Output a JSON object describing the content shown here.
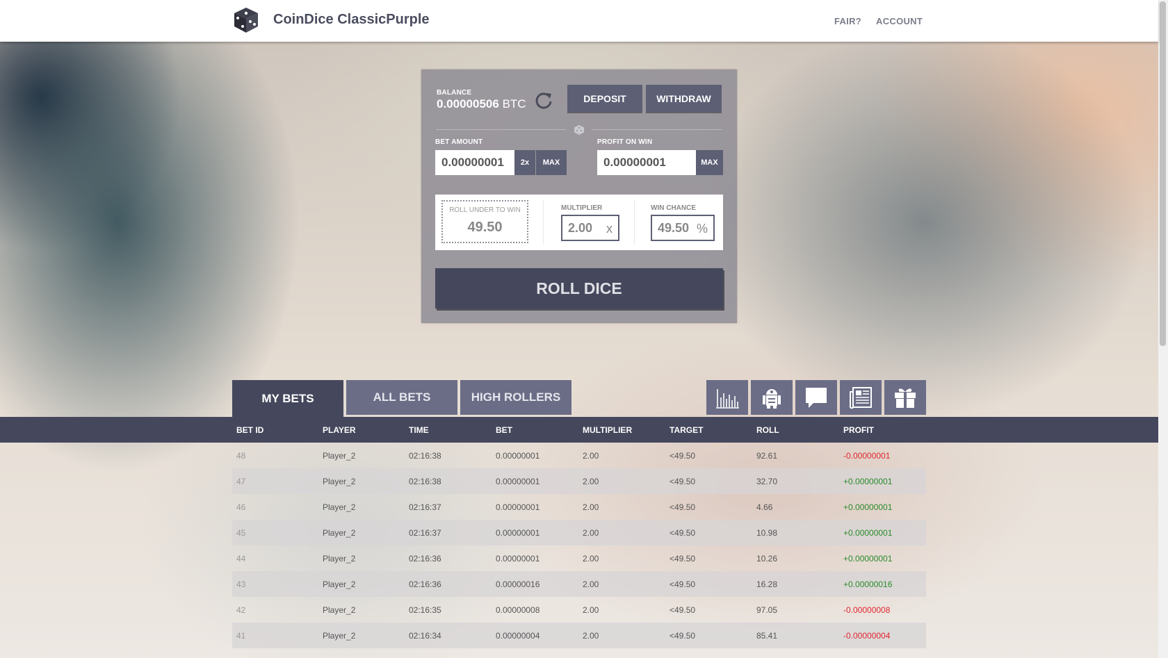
{
  "header": {
    "brand": "CoinDice ClassicPurple",
    "nav": [
      "FAIR?",
      "ACCOUNT"
    ]
  },
  "panel": {
    "balance_label": "BALANCE",
    "balance_value": "0.00000506",
    "balance_unit": "BTC",
    "deposit_label": "DEPOSIT",
    "withdraw_label": "WITHDRAW",
    "bet_amount_label": "BET AMOUNT",
    "bet_amount_value": "0.00000001",
    "double_label": "2x",
    "max_label": "MAX",
    "profit_label": "PROFIT ON WIN",
    "profit_value": "0.00000001",
    "profit_max_label": "MAX",
    "roll_under_label": "ROLL UNDER TO WIN",
    "roll_under_value": "49.50",
    "multiplier_label": "MULTIPLIER",
    "multiplier_value": "2.00",
    "multiplier_unit": "x",
    "win_chance_label": "WIN CHANCE",
    "win_chance_value": "49.50",
    "win_chance_unit": "%",
    "roll_button": "ROLL DICE"
  },
  "tabs": [
    "MY BETS",
    "ALL BETS",
    "HIGH ROLLERS"
  ],
  "tool_icons": [
    "stats-icon",
    "robot-icon",
    "chat-icon",
    "news-icon",
    "gift-icon"
  ],
  "colors": {
    "accent": "#45475c",
    "secondary": "#6b6d86",
    "loss": "#e0262f",
    "win": "#2a8a2a"
  },
  "table": {
    "columns": [
      "BET ID",
      "PLAYER",
      "TIME",
      "BET",
      "MULTIPLIER",
      "TARGET",
      "ROLL",
      "PROFIT"
    ],
    "rows": [
      [
        "48",
        "Player_2",
        "02:16:38",
        "0.00000001",
        "2.00",
        "<49.50",
        "92.61",
        "-0.00000001"
      ],
      [
        "47",
        "Player_2",
        "02:16:38",
        "0.00000001",
        "2.00",
        "<49.50",
        "32.70",
        "+0.00000001"
      ],
      [
        "46",
        "Player_2",
        "02:16:37",
        "0.00000001",
        "2.00",
        "<49.50",
        "4.66",
        "+0.00000001"
      ],
      [
        "45",
        "Player_2",
        "02:16:37",
        "0.00000001",
        "2.00",
        "<49.50",
        "10.98",
        "+0.00000001"
      ],
      [
        "44",
        "Player_2",
        "02:16:36",
        "0.00000001",
        "2.00",
        "<49.50",
        "10.26",
        "+0.00000001"
      ],
      [
        "43",
        "Player_2",
        "02:16:36",
        "0.00000016",
        "2.00",
        "<49.50",
        "16.28",
        "+0.00000016"
      ],
      [
        "42",
        "Player_2",
        "02:16:35",
        "0.00000008",
        "2.00",
        "<49.50",
        "97.05",
        "-0.00000008"
      ],
      [
        "41",
        "Player_2",
        "02:16:34",
        "0.00000004",
        "2.00",
        "<49.50",
        "85.41",
        "-0.00000004"
      ]
    ]
  }
}
